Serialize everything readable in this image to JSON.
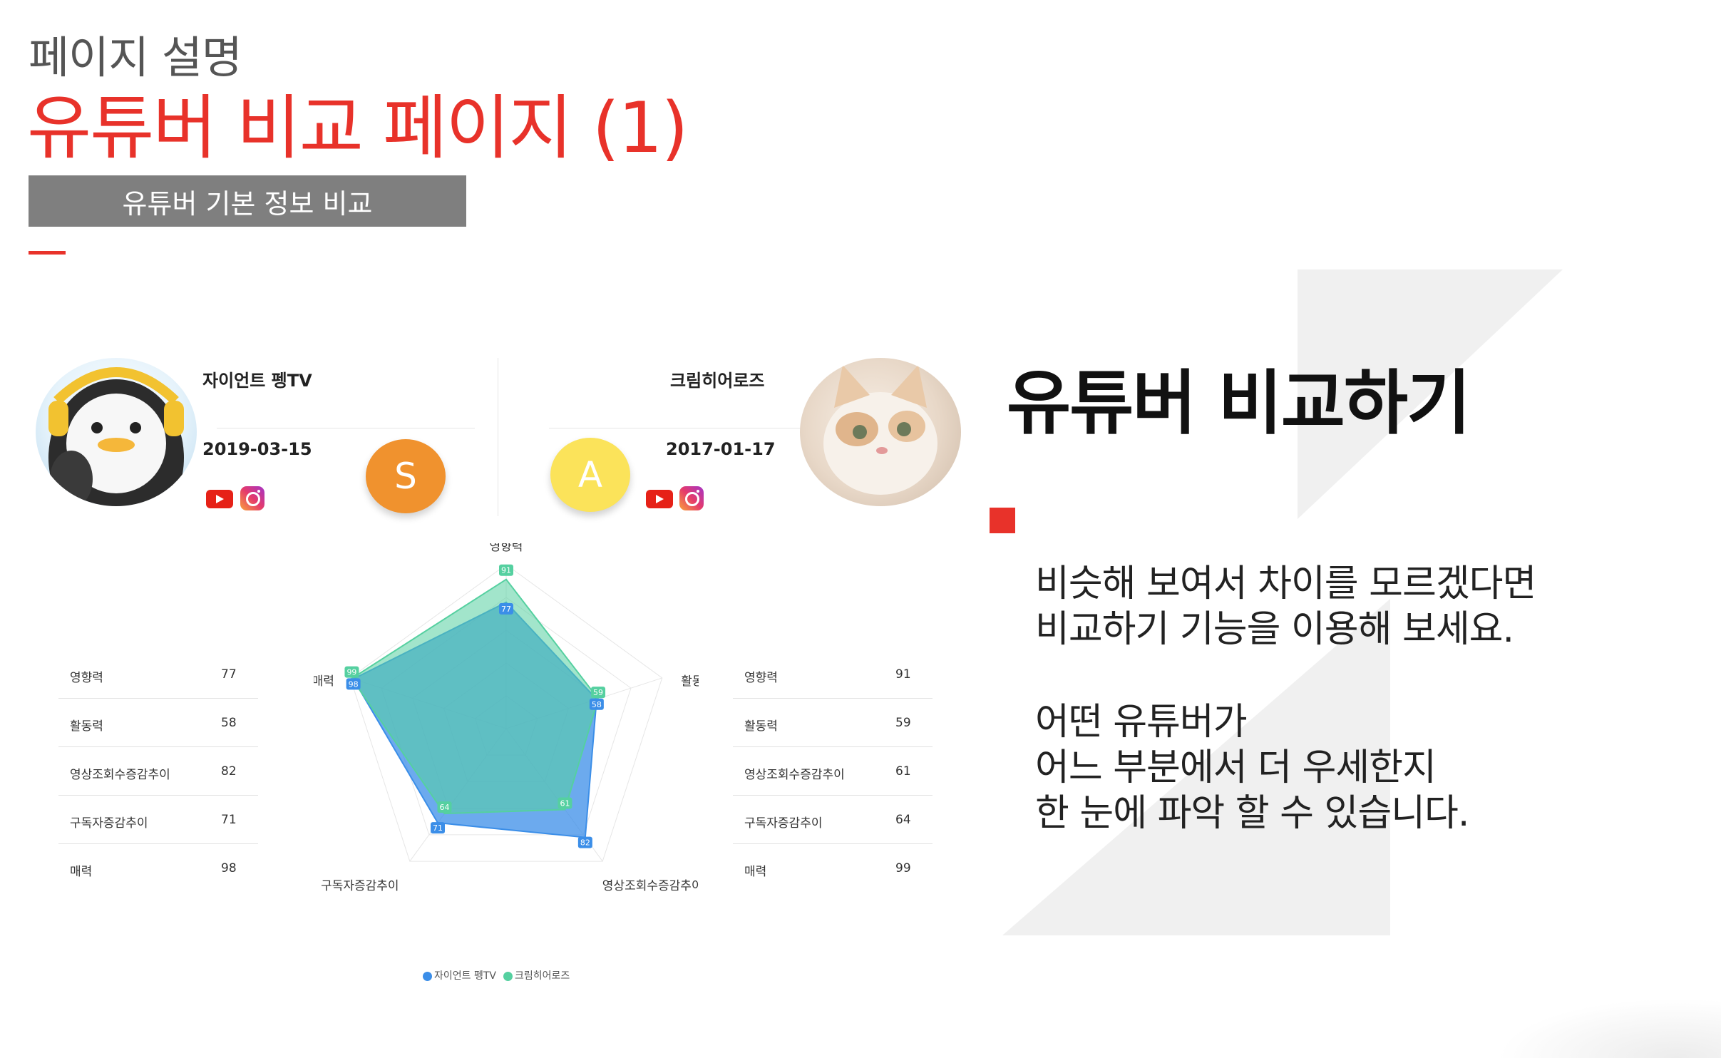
{
  "header": {
    "subtitle": "페이지 설명",
    "title": "유튜버 비교 페이지 (1)",
    "section_label": "유튜버 기본 정보 비교"
  },
  "colors": {
    "accent": "#e8322a",
    "section_bar": "#7f7f7f",
    "badge_s": "#f0922e",
    "badge_a": "#fbe35a",
    "series_left": "#3b8ee8",
    "series_right": "#55d0a0"
  },
  "compare": {
    "left": {
      "name": "자이언트 펭TV",
      "date": "2019-03-15",
      "grade": "S",
      "icons": [
        "youtube-icon",
        "instagram-icon"
      ]
    },
    "right": {
      "name": "크림히어로즈",
      "date": "2017-01-17",
      "grade": "A",
      "icons": [
        "youtube-icon",
        "instagram-icon"
      ]
    }
  },
  "stats_left": [
    {
      "label": "영향력",
      "value": "77"
    },
    {
      "label": "활동력",
      "value": "58"
    },
    {
      "label": "영상조회수증감추이",
      "value": "82"
    },
    {
      "label": "구독자증감추이",
      "value": "71"
    },
    {
      "label": "매력",
      "value": "98"
    }
  ],
  "stats_right": [
    {
      "label": "영향력",
      "value": "91"
    },
    {
      "label": "활동력",
      "value": "59"
    },
    {
      "label": "영상조회수증감추이",
      "value": "61"
    },
    {
      "label": "구독자증감추이",
      "value": "64"
    },
    {
      "label": "매력",
      "value": "99"
    }
  ],
  "chart_data": {
    "type": "radar",
    "axes": [
      "영향력",
      "활동력",
      "영상조회수증감추이",
      "구독자증감추이",
      "매력"
    ],
    "range": [
      0,
      100
    ],
    "series": [
      {
        "name": "자이언트 펭TV",
        "values": [
          77,
          58,
          82,
          71,
          98
        ],
        "color": "#3b8ee8"
      },
      {
        "name": "크림히어로즈",
        "values": [
          91,
          59,
          61,
          64,
          99
        ],
        "color": "#55d0a0"
      }
    ]
  },
  "right_panel": {
    "heading": "유튜버 비교하기",
    "lines": [
      "비슷해 보여서 차이를 모르겠다면",
      "비교하기 기능을 이용해 보세요.",
      "어떤 유튜버가",
      "어느 부분에서 더 우세한지",
      "한 눈에 파악 할 수 있습니다."
    ]
  }
}
